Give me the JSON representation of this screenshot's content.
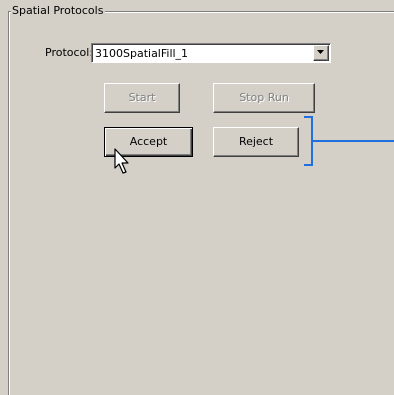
{
  "group": {
    "title": "Spatial Protocols"
  },
  "protocol": {
    "label": "Protocol:",
    "selected": "3100SpatialFill_1"
  },
  "buttons": {
    "start": "Start",
    "stop_run": "Stop Run",
    "accept": "Accept",
    "reject": "Reject"
  },
  "states": {
    "start_enabled": false,
    "stop_run_enabled": false
  },
  "colors": {
    "background": "#d4d0c8",
    "connector": "#1f6fe0"
  },
  "icons": {
    "combo": "chevron-down-icon",
    "pointer": "mouse-cursor-icon"
  }
}
